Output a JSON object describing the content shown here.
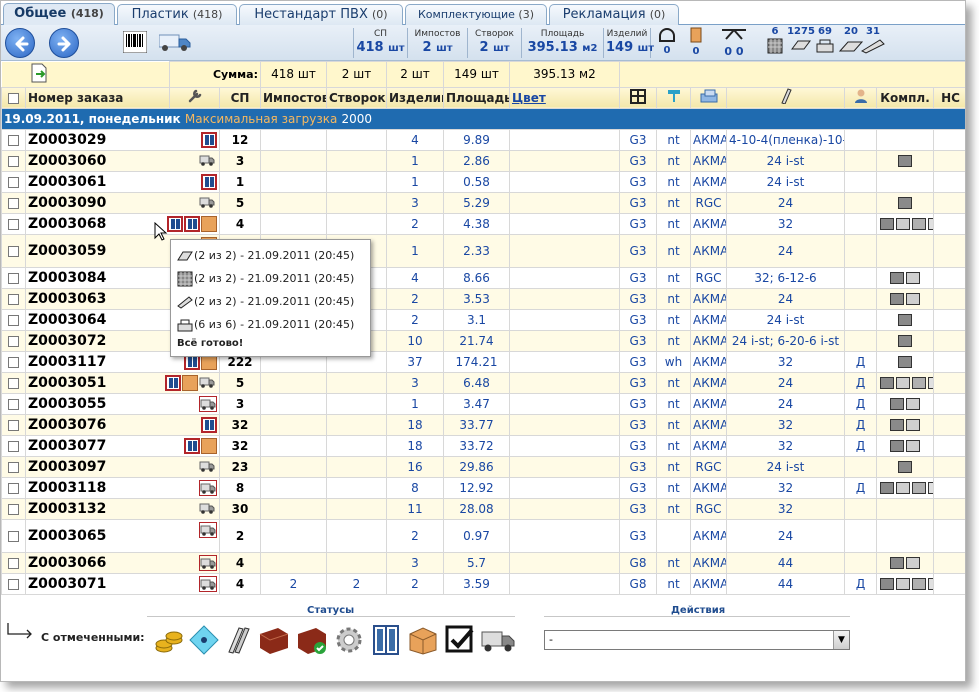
{
  "tabs": [
    {
      "label": "Общее",
      "count": "(418)",
      "active": true
    },
    {
      "label": "Пластик",
      "count": "(418)"
    },
    {
      "label": "Нестандарт ПВХ",
      "count": "(0)"
    },
    {
      "label": "Комплектующие",
      "count": "(3)"
    },
    {
      "label": "Рекламация",
      "count": "(0)"
    }
  ],
  "toolbar": {
    "stats": [
      {
        "label": "СП",
        "value": "418",
        "unit": "шт"
      },
      {
        "label": "Импостов",
        "value": "2",
        "unit": "шт"
      },
      {
        "label": "Створок",
        "value": "2",
        "unit": "шт"
      },
      {
        "label": "Площадь",
        "value": "395.13",
        "unit": "м2"
      },
      {
        "label": "Изделий",
        "value": "149",
        "unit": "шт"
      }
    ],
    "counts": [
      "0",
      "0",
      "0",
      "6",
      "1275",
      "69",
      "20",
      "31"
    ]
  },
  "summary": {
    "label": "Сумма:",
    "sp": "418 шт",
    "imp": "2 шт",
    "stv": "2 шт",
    "izd": "149 шт",
    "area": "395.13 м2"
  },
  "headers": {
    "order": "Номер заказа",
    "sp": "СП",
    "imp": "Импостов",
    "stv": "Створок",
    "izd": "Изделий",
    "area": "Площадь",
    "color": "Цвет",
    "kompl": "Компл.",
    "extra": "НС"
  },
  "group": {
    "date": "19.09.2011, понедельник",
    "max_label": "Максимальная загрузка",
    "max_value": "2000"
  },
  "rows": [
    {
      "order": "Z0003029",
      "sp": "12",
      "imp": "",
      "stv": "",
      "izd": "4",
      "area": "9.89",
      "g": "G3",
      "nt": "nt",
      "prof": "АКМА",
      "glass": "4-10-4(пленка)-10-4",
      "d": "",
      "icons": [
        "win"
      ],
      "kompl": 0
    },
    {
      "order": "Z0003060",
      "sp": "3",
      "imp": "",
      "stv": "",
      "izd": "1",
      "area": "2.86",
      "g": "G3",
      "nt": "nt",
      "prof": "АКМА",
      "glass": "24 i-st",
      "d": "",
      "icons": [
        "truck"
      ],
      "kompl": 1
    },
    {
      "order": "Z0003061",
      "sp": "1",
      "imp": "",
      "stv": "",
      "izd": "1",
      "area": "0.58",
      "g": "G3",
      "nt": "nt",
      "prof": "АКМА",
      "glass": "24 i-st",
      "d": "",
      "icons": [
        "win"
      ],
      "kompl": 0
    },
    {
      "order": "Z0003090",
      "sp": "5",
      "imp": "",
      "stv": "",
      "izd": "3",
      "area": "5.29",
      "g": "G3",
      "nt": "nt",
      "prof": "RGC",
      "glass": "24",
      "d": "",
      "icons": [
        "truck"
      ],
      "kompl": 1
    },
    {
      "order": "Z0003068",
      "sp": "4",
      "imp": "",
      "stv": "",
      "izd": "2",
      "area": "4.38",
      "g": "G3",
      "nt": "nt",
      "prof": "АКМА",
      "glass": "32",
      "d": "",
      "icons": [
        "win",
        "win",
        "box"
      ],
      "kompl": 4
    },
    {
      "order": "Z0003059",
      "sp": "",
      "imp": "",
      "stv": "",
      "izd": "1",
      "area": "2.33",
      "g": "G3",
      "nt": "nt",
      "prof": "АКМА",
      "glass": "24",
      "d": "",
      "icons": [
        "box"
      ],
      "kompl": 0
    },
    {
      "order": "Z0003084",
      "sp": "",
      "imp": "",
      "stv": "",
      "izd": "4",
      "area": "8.66",
      "g": "G3",
      "nt": "nt",
      "prof": "RGC",
      "glass": "32; 6-12-6",
      "d": "",
      "icons": [
        "win",
        "box"
      ],
      "kompl": 2
    },
    {
      "order": "Z0003063",
      "sp": "",
      "imp": "",
      "stv": "",
      "izd": "2",
      "area": "3.53",
      "g": "G3",
      "nt": "nt",
      "prof": "АКМА",
      "glass": "24",
      "d": "",
      "icons": [
        "truckr"
      ],
      "kompl": 2
    },
    {
      "order": "Z0003064",
      "sp": "",
      "imp": "",
      "stv": "",
      "izd": "2",
      "area": "3.1",
      "g": "G3",
      "nt": "nt",
      "prof": "АКМА",
      "glass": "24 i-st",
      "d": "",
      "icons": [
        "truck"
      ],
      "kompl": 1
    },
    {
      "order": "Z0003072",
      "sp": "",
      "imp": "",
      "stv": "",
      "izd": "10",
      "area": "21.74",
      "g": "G3",
      "nt": "nt",
      "prof": "АКМА",
      "glass": "24 i-st; 6-20-6 i-st",
      "d": "",
      "icons": [
        "win",
        "box"
      ],
      "kompl": 1
    },
    {
      "order": "Z0003117",
      "sp": "222",
      "imp": "",
      "stv": "",
      "izd": "37",
      "area": "174.21",
      "g": "G3",
      "nt": "wh",
      "prof": "АКМА",
      "glass": "32",
      "d": "Д",
      "icons": [
        "win",
        "box"
      ],
      "kompl": 1
    },
    {
      "order": "Z0003051",
      "sp": "5",
      "imp": "",
      "stv": "",
      "izd": "3",
      "area": "6.48",
      "g": "G3",
      "nt": "nt",
      "prof": "АКМА",
      "glass": "24",
      "d": "Д",
      "icons": [
        "win",
        "box",
        "truck"
      ],
      "kompl": 4
    },
    {
      "order": "Z0003055",
      "sp": "3",
      "imp": "",
      "stv": "",
      "izd": "1",
      "area": "3.47",
      "g": "G3",
      "nt": "nt",
      "prof": "АКМА",
      "glass": "24",
      "d": "Д",
      "icons": [
        "truckr"
      ],
      "kompl": 2
    },
    {
      "order": "Z0003076",
      "sp": "32",
      "imp": "",
      "stv": "",
      "izd": "18",
      "area": "33.77",
      "g": "G3",
      "nt": "nt",
      "prof": "АКМА",
      "glass": "32",
      "d": "Д",
      "icons": [
        "win"
      ],
      "kompl": 2
    },
    {
      "order": "Z0003077",
      "sp": "32",
      "imp": "",
      "stv": "",
      "izd": "18",
      "area": "33.72",
      "g": "G3",
      "nt": "nt",
      "prof": "АКМА",
      "glass": "32",
      "d": "Д",
      "icons": [
        "win",
        "box"
      ],
      "kompl": 2
    },
    {
      "order": "Z0003097",
      "sp": "23",
      "imp": "",
      "stv": "",
      "izd": "16",
      "area": "29.86",
      "g": "G3",
      "nt": "nt",
      "prof": "RGC",
      "glass": "24 i-st",
      "d": "",
      "icons": [
        "truck"
      ],
      "kompl": 1
    },
    {
      "order": "Z0003118",
      "sp": "8",
      "imp": "",
      "stv": "",
      "izd": "8",
      "area": "12.92",
      "g": "G3",
      "nt": "nt",
      "prof": "АКМА",
      "glass": "32",
      "d": "Д",
      "icons": [
        "truckr"
      ],
      "kompl": 4
    },
    {
      "order": "Z0003132",
      "sp": "30",
      "imp": "",
      "stv": "",
      "izd": "11",
      "area": "28.08",
      "g": "G3",
      "nt": "nt",
      "prof": "RGC",
      "glass": "32",
      "d": "",
      "icons": [
        "truck"
      ],
      "kompl": 0
    },
    {
      "order": "Z0003065",
      "sp": "2",
      "imp": "",
      "stv": "",
      "izd": "2",
      "area": "0.97",
      "g": "G3",
      "nt": "",
      "prof": "АКМА",
      "glass": "24",
      "d": "",
      "icons": [
        "truckr"
      ],
      "kompl": 0
    },
    {
      "order": "Z0003066",
      "sp": "4",
      "imp": "",
      "stv": "",
      "izd": "3",
      "area": "5.7",
      "g": "G8",
      "nt": "nt",
      "prof": "АКМА",
      "glass": "44",
      "d": "",
      "icons": [
        "truckr"
      ],
      "kompl": 2
    },
    {
      "order": "Z0003071",
      "sp": "4",
      "imp": "2",
      "stv": "2",
      "izd": "2",
      "area": "3.59",
      "g": "G8",
      "nt": "nt",
      "prof": "АКМА",
      "glass": "44",
      "d": "Д",
      "icons": [
        "truckr"
      ],
      "kompl": 4
    }
  ],
  "popup": {
    "lines": [
      "(2 из 2) - 21.09.2011 (20:45)",
      "(2 из 2) - 21.09.2011 (20:45)",
      "(2 из 2) - 21.09.2011 (20:45)",
      "(6 из 6) - 21.09.2011 (20:45)"
    ],
    "ready": "Всё готово!"
  },
  "footer": {
    "statuses": "Статусы",
    "actions": "Действия",
    "with_checked": "С отмеченными:",
    "select_value": "-"
  },
  "colors": {
    "accent": "#1f6bb0",
    "highlight": "#fff7cc",
    "danger": "#b2252a"
  }
}
